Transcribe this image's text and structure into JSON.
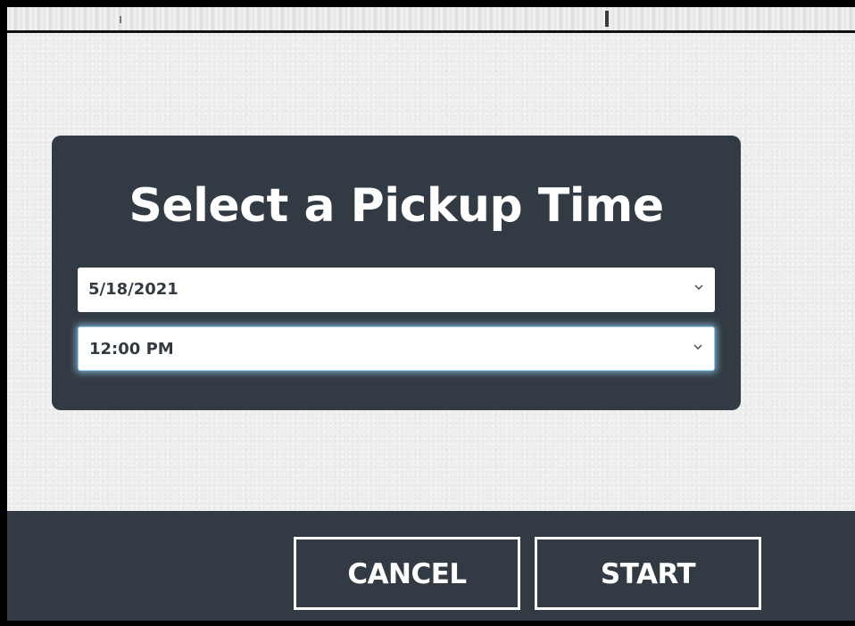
{
  "dialog": {
    "title": "Select a Pickup Time"
  },
  "pickup_date": {
    "selected": "5/18/2021",
    "icon": "chevron-down-icon"
  },
  "pickup_time": {
    "selected": "12:00 PM",
    "icon": "chevron-down-icon",
    "focused": true
  },
  "actions": {
    "cancel_label": "CANCEL",
    "start_label": "START"
  },
  "colors": {
    "panel": "#323b43",
    "background": "#efefef",
    "focus_glow": "#8ecdf0",
    "text_on_panel": "#ffffff"
  }
}
